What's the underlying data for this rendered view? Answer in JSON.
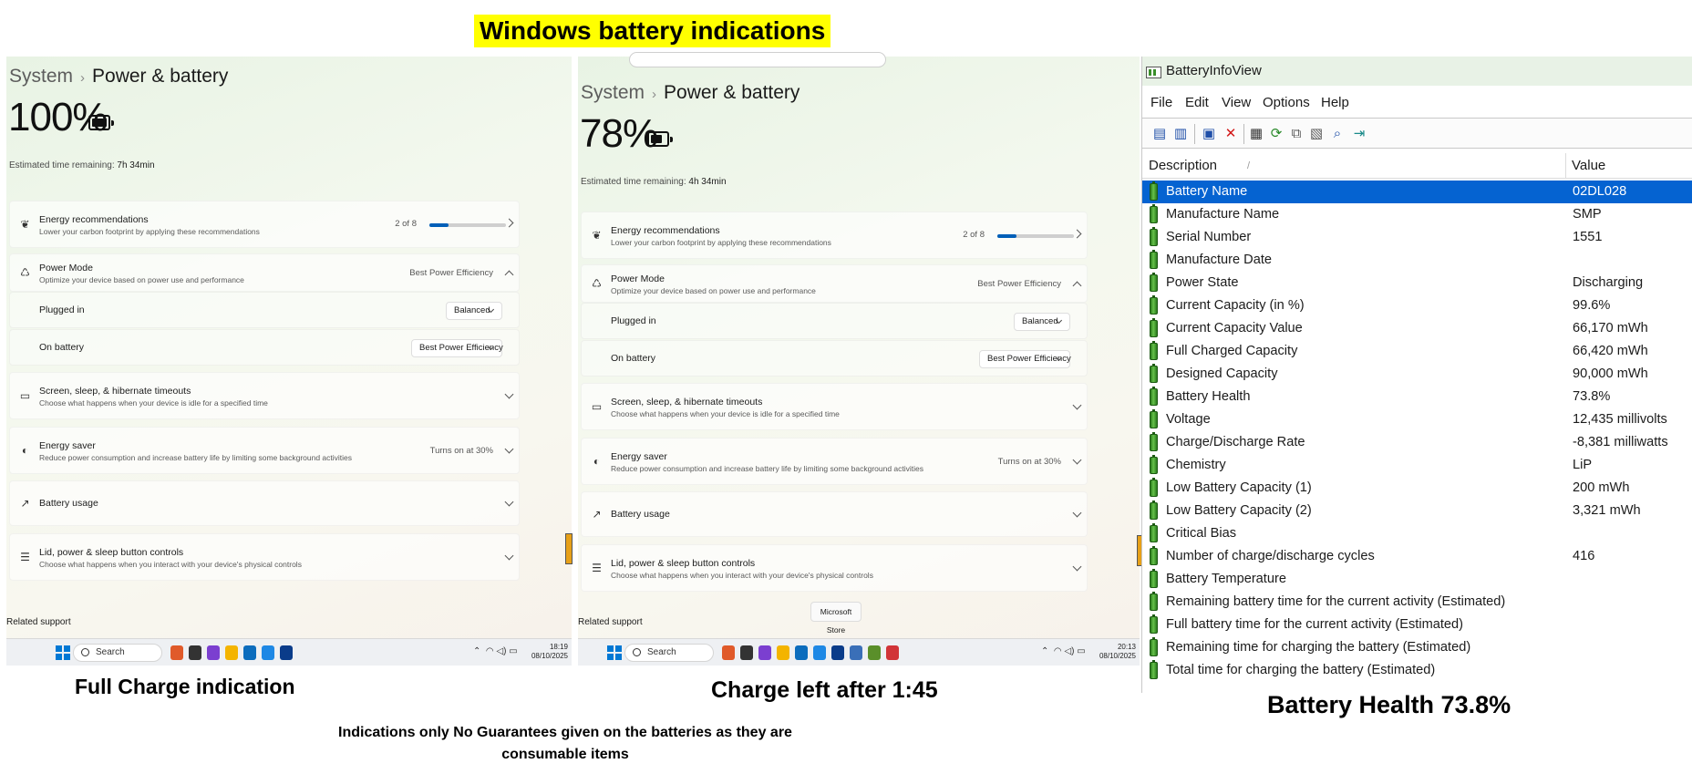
{
  "header": {
    "title": "Windows battery indications"
  },
  "captions": {
    "left": "Full Charge indication",
    "middle": "Charge left after 1:45",
    "right": "Battery Health 73.8%"
  },
  "disclaimer": "Indications only No Guarantees given on the batteries as they are consumable items",
  "settings_panels": [
    {
      "breadcrumb": {
        "parent": "System",
        "separator": "›",
        "page": "Power & battery"
      },
      "battery_percent": "100%",
      "battery_level": 1.0,
      "estimate": {
        "label": "Estimated time remaining:",
        "value": "7h 34min"
      },
      "energy_recommendations": {
        "title": "Energy recommendations",
        "subtitle": "Lower your carbon footprint by applying these recommendations",
        "progress_text": "2 of 8",
        "progress": 0.25
      },
      "power_mode": {
        "title": "Power Mode",
        "subtitle": "Optimize your device based on power use and performance",
        "value": "Best Power Efficiency"
      },
      "plugged_in": {
        "label": "Plugged in",
        "value": "Balanced"
      },
      "on_battery": {
        "label": "On battery",
        "value": "Best Power Efficiency"
      },
      "screen_sleep": {
        "title": "Screen, sleep, & hibernate timeouts",
        "subtitle": "Choose what happens when your device is idle for a specified time"
      },
      "energy_saver": {
        "title": "Energy saver",
        "subtitle": "Reduce power consumption and increase battery life by limiting some background activities",
        "value": "Turns on at 30%"
      },
      "battery_usage": {
        "title": "Battery usage"
      },
      "lid_controls": {
        "title": "Lid, power & sleep button controls",
        "subtitle": "Choose what happens when you interact with your device's physical controls"
      },
      "related_support": "Related support",
      "taskbar": {
        "search_label": "Search",
        "time": "18:19",
        "date": "08/10/2025"
      }
    },
    {
      "breadcrumb": {
        "parent": "System",
        "separator": "›",
        "page": "Power & battery"
      },
      "battery_percent": "78%",
      "battery_level": 0.78,
      "estimate": {
        "label": "Estimated time remaining:",
        "value": "4h 34min"
      },
      "energy_recommendations": {
        "title": "Energy recommendations",
        "subtitle": "Lower your carbon footprint by applying these recommendations",
        "progress_text": "2 of 8",
        "progress": 0.25
      },
      "power_mode": {
        "title": "Power Mode",
        "subtitle": "Optimize your device based on power use and performance",
        "value": "Best Power Efficiency"
      },
      "plugged_in": {
        "label": "Plugged in",
        "value": "Balanced"
      },
      "on_battery": {
        "label": "On battery",
        "value": "Best Power Efficiency"
      },
      "screen_sleep": {
        "title": "Screen, sleep, & hibernate timeouts",
        "subtitle": "Choose what happens when your device is idle for a specified time"
      },
      "energy_saver": {
        "title": "Energy saver",
        "subtitle": "Reduce power consumption and increase battery life by limiting some background activities",
        "value": "Turns on at 30%"
      },
      "battery_usage": {
        "title": "Battery usage"
      },
      "lid_controls": {
        "title": "Lid, power & sleep button controls",
        "subtitle": "Choose what happens when you interact with your device's physical controls"
      },
      "related_support": "Related support",
      "tooltip": "Microsoft Store",
      "taskbar": {
        "search_label": "Search",
        "time": "20:13",
        "date": "08/10/2025"
      }
    }
  ],
  "battery_info_view": {
    "title": "BatteryInfoView",
    "menu": [
      "File",
      "Edit",
      "View",
      "Options",
      "Help"
    ],
    "columns": {
      "description": "Description",
      "value": "Value"
    },
    "rows": [
      {
        "desc": "Battery Name",
        "value": "02DL028",
        "selected": true
      },
      {
        "desc": "Manufacture Name",
        "value": "SMP"
      },
      {
        "desc": "Serial Number",
        "value": "1551"
      },
      {
        "desc": "Manufacture Date",
        "value": ""
      },
      {
        "desc": "Power State",
        "value": "Discharging"
      },
      {
        "desc": "Current Capacity (in %)",
        "value": "99.6%"
      },
      {
        "desc": "Current Capacity Value",
        "value": "66,170 mWh"
      },
      {
        "desc": "Full Charged Capacity",
        "value": "66,420 mWh"
      },
      {
        "desc": "Designed Capacity",
        "value": "90,000 mWh"
      },
      {
        "desc": "Battery Health",
        "value": "73.8%"
      },
      {
        "desc": "Voltage",
        "value": "12,435 millivolts"
      },
      {
        "desc": "Charge/Discharge Rate",
        "value": "-8,381 milliwatts"
      },
      {
        "desc": "Chemistry",
        "value": "LiP"
      },
      {
        "desc": "Low Battery Capacity (1)",
        "value": "200 mWh"
      },
      {
        "desc": "Low Battery Capacity (2)",
        "value": "3,321 mWh"
      },
      {
        "desc": "Critical Bias",
        "value": ""
      },
      {
        "desc": "Number of charge/discharge cycles",
        "value": "416"
      },
      {
        "desc": "Battery Temperature",
        "value": ""
      },
      {
        "desc": "Remaining battery time for the current activity (Estimated)",
        "value": ""
      },
      {
        "desc": "Full battery time for the current activity (Estimated)",
        "value": ""
      },
      {
        "desc": "Remaining time for charging the battery (Estimated)",
        "value": ""
      },
      {
        "desc": "Total  time for charging the battery (Estimated)",
        "value": ""
      }
    ]
  }
}
